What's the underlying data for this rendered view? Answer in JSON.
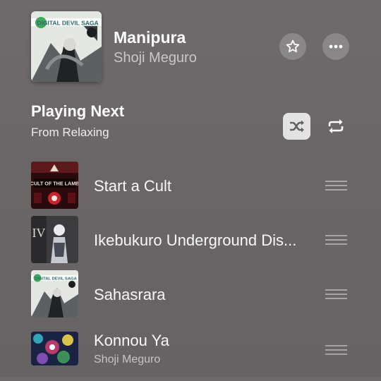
{
  "now_playing": {
    "title": "Manipura",
    "artist": "Shoji Meguro",
    "album_text": "DIGITAL DEVIL SAGA"
  },
  "queue": {
    "heading": "Playing Next",
    "source": "From Relaxing",
    "items": [
      {
        "title": "Start a Cult",
        "artist": "",
        "art_text": "CULT OF THE LAMB"
      },
      {
        "title": "Ikebukuro Underground Dis...",
        "artist": "",
        "art_text": "IV"
      },
      {
        "title": "Sahasrara",
        "artist": "",
        "art_text": "DIGITAL DEVIL SAGA"
      },
      {
        "title": "Konnou Ya",
        "artist": "Shoji Meguro",
        "art_text": ""
      }
    ]
  },
  "icons": {
    "favorite": "star-icon",
    "more": "ellipsis-icon",
    "shuffle": "shuffle-icon",
    "repeat": "repeat-icon",
    "reorder": "reorder-handle-icon"
  },
  "colors": {
    "background": "#6c6869",
    "shuffle_active_bg": "#d9d7d8"
  }
}
